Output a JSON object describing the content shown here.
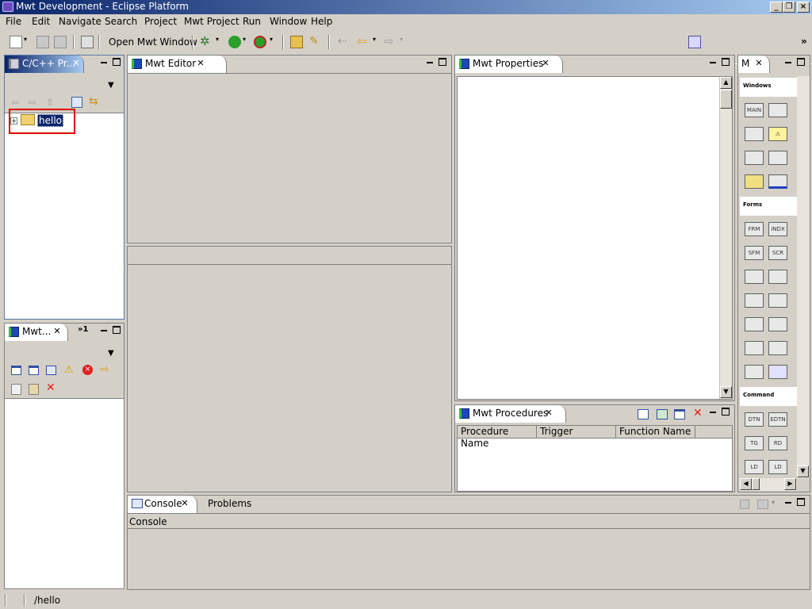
{
  "window": {
    "title": "Mwt Development - Eclipse Platform"
  },
  "menubar": [
    "File",
    "Edit",
    "Navigate",
    "Search",
    "Project",
    "Mwt Project",
    "Run",
    "Window",
    "Help"
  ],
  "toolbar": {
    "open_window_label": "Open Mwt Window"
  },
  "project_explorer": {
    "tab_label": "C/C++ Pr...",
    "tree_item": "hello"
  },
  "mwt_panel": {
    "tab_label": "Mwt...",
    "overflow": "»1"
  },
  "editor": {
    "tab_label": "Mwt Editor"
  },
  "properties": {
    "tab_label": "Mwt Properties"
  },
  "procedures": {
    "tab_label": "Mwt Procedures",
    "columns": [
      "Procedure Name",
      "Trigger",
      "Function Name"
    ]
  },
  "palette": {
    "tab_label": "M",
    "sections": [
      "Windows",
      "Forms",
      "Command"
    ],
    "windows_items": [
      "MAIN",
      "",
      "",
      "⚠",
      "",
      "",
      "",
      ""
    ],
    "forms_items": [
      "FRM",
      "INDX",
      "SFM",
      "SCR",
      "",
      "",
      "",
      "",
      "",
      "",
      "",
      "",
      "",
      "",
      ""
    ],
    "command_items": [
      "DTN",
      "EDTN",
      "TG",
      "RD",
      "LD",
      "LD"
    ]
  },
  "console": {
    "tab_label": "Console",
    "tab2_label": "Problems",
    "header": "Console"
  },
  "statusbar": {
    "path": "/hello"
  },
  "colors": {
    "highlight": "#e00000",
    "selection": "#0a246a"
  }
}
